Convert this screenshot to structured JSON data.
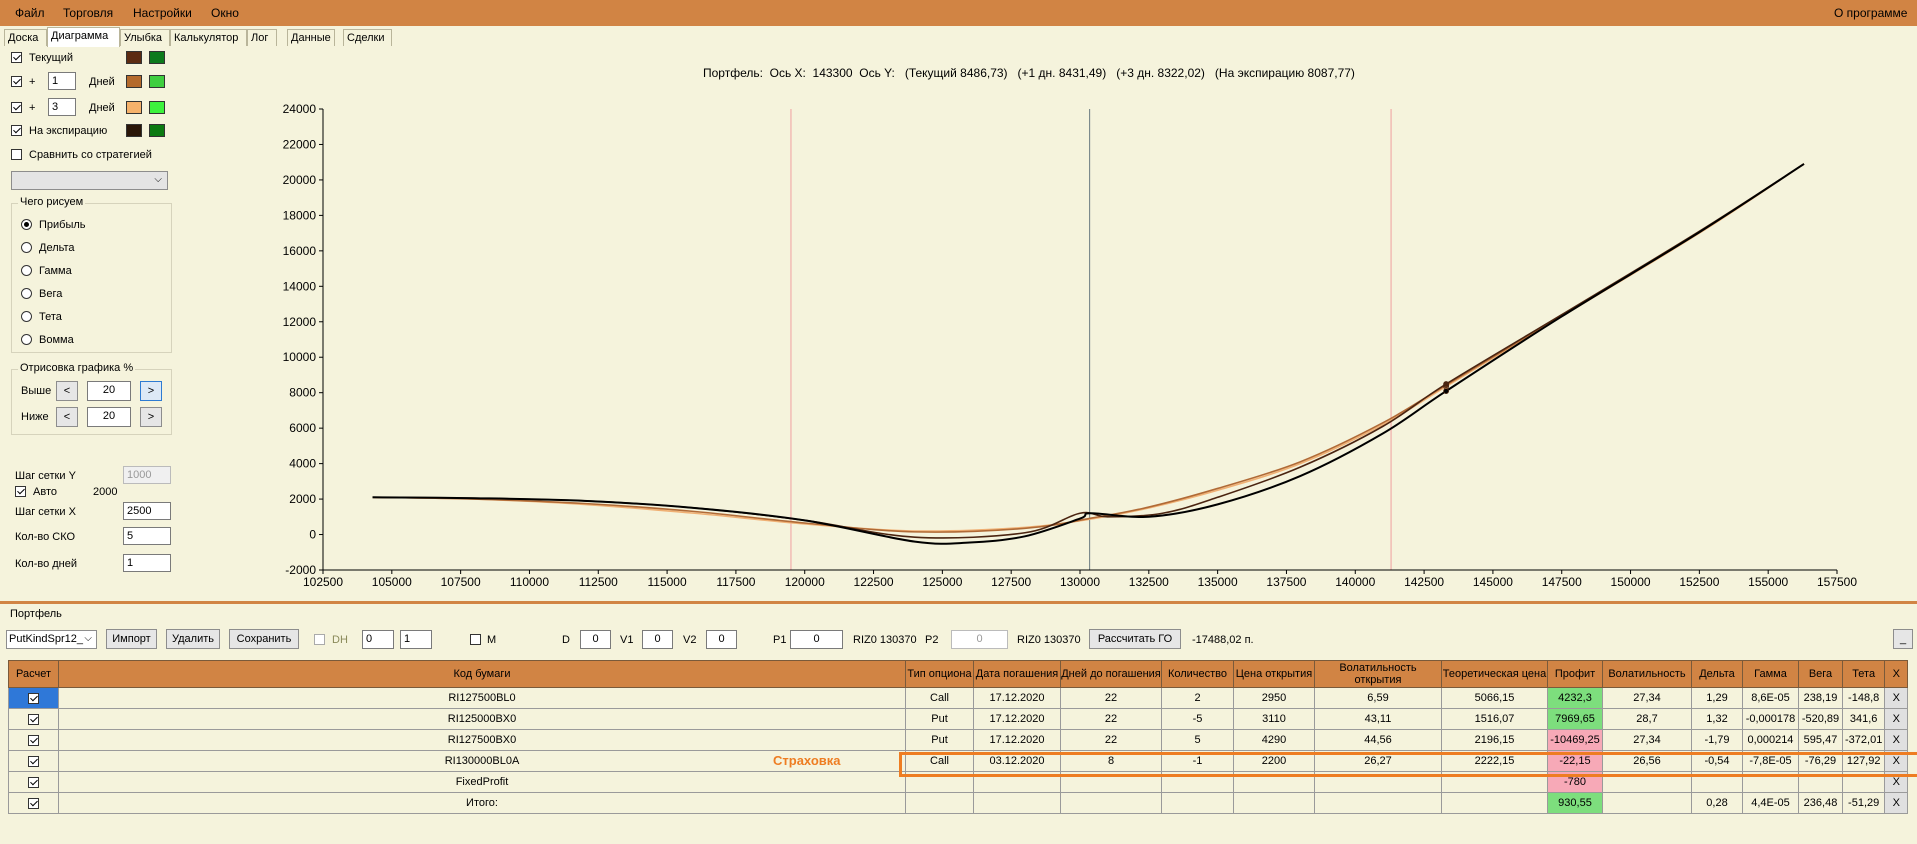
{
  "menu": {
    "items": [
      "Файл",
      "Торговля",
      "Настройки",
      "Окно"
    ],
    "about": "О программе"
  },
  "tabs": [
    "Доска",
    "Диаграмма",
    "Улыбка",
    "Калькулятор",
    "Лог",
    "Данные",
    "Сделки"
  ],
  "active_tab": "Диаграмма",
  "left": {
    "current_label": "Текущий",
    "plus_label": "+",
    "days_label": "Дней",
    "plus1_value": "1",
    "plus3_value": "3",
    "expiry_label": "На экспирацию",
    "compare_label": "Сравнить со стратегией",
    "swatches": {
      "current": [
        "#5c2b12",
        "#0d7a1c"
      ],
      "plus1": [
        "#b46a2c",
        "#3fce3f"
      ],
      "plus3": [
        "#f6b26b",
        "#3df23d"
      ],
      "expiry": [
        "#2a1608",
        "#0c7a12"
      ]
    },
    "draw_group_title": "Чего рисуем",
    "radio_options": [
      "Прибыль",
      "Дельта",
      "Гамма",
      "Вега",
      "Тета",
      "Вомма"
    ],
    "radio_selected": "Прибыль",
    "render_group_title": "Отрисовка графика %",
    "above_label": "Выше",
    "above_value": "20",
    "below_label": "Ниже",
    "below_value": "20",
    "prev_symbol": "<",
    "next_symbol": ">",
    "grid_y_label": "Шаг сетки Y",
    "grid_y_value": "1000",
    "auto_label": "Авто",
    "auto_value": "2000",
    "grid_x_label": "Шаг сетки X",
    "grid_x_value": "2500",
    "sko_label": "Кол-во СКО",
    "sko_value": "5",
    "days_count_label": "Кол-во дней",
    "days_count_value": "1"
  },
  "chart_header": "Портфель:  Ось X:  143300  Ось Y:   (Текущий 8486,73)   (+1 дн. 8431,49)   (+3 дн. 8322,02)   (На экспирацию 8087,77)",
  "chart_data": {
    "type": "line",
    "xlim": [
      102500,
      157500
    ],
    "ylim": [
      -2000,
      24000
    ],
    "x_ticks": [
      102500,
      105000,
      107500,
      110000,
      112500,
      115000,
      117500,
      120000,
      122500,
      125000,
      127500,
      130000,
      132500,
      135000,
      137500,
      140000,
      142500,
      145000,
      147500,
      150000,
      152500,
      155000,
      157500
    ],
    "y_ticks": [
      -2000,
      0,
      2000,
      4000,
      6000,
      8000,
      10000,
      12000,
      14000,
      16000,
      18000,
      20000,
      22000,
      24000
    ],
    "vlines_red": [
      119500,
      141300
    ],
    "vline_current": 130350,
    "cursor_x": 143300,
    "series": [
      {
        "color": "#f0b074",
        "x": [
          104300,
          108000,
          112000,
          116000,
          120000,
          124000,
          128000,
          130500,
          132500,
          135000,
          138000,
          141000,
          143300,
          147500,
          152500,
          156300
        ],
        "y": [
          2100,
          2000,
          1700,
          1200,
          600,
          200,
          400,
          900,
          1500,
          2500,
          4000,
          6200,
          8350,
          12300,
          17000,
          20900
        ]
      },
      {
        "color": "#b06a36",
        "x": [
          104300,
          108000,
          112000,
          116000,
          120000,
          124000,
          128000,
          130500,
          132500,
          135000,
          138000,
          141000,
          143300,
          147500,
          152500,
          156300
        ],
        "y": [
          2100,
          2000,
          1750,
          1300,
          650,
          150,
          350,
          950,
          1550,
          2600,
          4100,
          6300,
          8430,
          12350,
          17050,
          20900
        ]
      },
      {
        "color": "#4a2410",
        "x": [
          104300,
          108000,
          112000,
          116000,
          120000,
          124000,
          128000,
          130000,
          131000,
          133000,
          135000,
          138000,
          141000,
          143300,
          147500,
          152500,
          156300
        ],
        "y": [
          2100,
          2050,
          1900,
          1500,
          800,
          -150,
          100,
          1200,
          1000,
          1200,
          2100,
          3800,
          6100,
          8490,
          12400,
          17100,
          20900
        ]
      },
      {
        "color": "#000000",
        "x": [
          104300,
          108000,
          112000,
          116000,
          120000,
          124000,
          126000,
          128000,
          130000,
          130400,
          132500,
          135000,
          138000,
          141000,
          143300,
          147500,
          152500,
          156300
        ],
        "y": [
          2100,
          2050,
          1900,
          1500,
          800,
          -400,
          -450,
          -100,
          900,
          1200,
          1000,
          1700,
          3300,
          5700,
          8090,
          12300,
          17050,
          20900
        ]
      }
    ]
  },
  "bottom": {
    "portfolio_label": "Портфель",
    "portfolio_select": "PutKindSpr12_",
    "import_label": "Импорт",
    "delete_label": "Удалить",
    "save_label": "Сохранить",
    "dh_label": "DH",
    "spin1": "0",
    "spin2": "1",
    "m_label": "M",
    "d_label": "D",
    "d_value": "0",
    "v1_label": "V1",
    "v1_value": "0",
    "v2_label": "V2",
    "v2_value": "0",
    "p1_label": "P1",
    "p1_value": "0",
    "riz_label1": "RIZ0 130370",
    "p2_label": "P2",
    "p2_value": "0",
    "riz_label2": "RIZ0 130370",
    "calc_go_label": "Рассчитать ГО",
    "go_value": "-17488,02 п.",
    "minimize_label": "_"
  },
  "table": {
    "headers": [
      "Расчет",
      "Код бумаги",
      "Тип опциона",
      "Дата погашения",
      "Дней до погашения",
      "Количество",
      "Цена открытия",
      "Волатильность открытия",
      "Теоретическая цена",
      "Профит",
      "Волатильность",
      "Дельта",
      "Гамма",
      "Вега",
      "Тета",
      "X"
    ],
    "rows": [
      {
        "code": "RI127500BL0",
        "type": "Call",
        "date": "17.12.2020",
        "days": "22",
        "qty": "2",
        "price": "2950",
        "vol_open": "6,59",
        "theor": "5066,15",
        "profit": "4232,3",
        "profit_color": "green",
        "vol": "27,34",
        "delta": "1,29",
        "gamma": "8,6E-05",
        "vega": "238,19",
        "theta": "-148,8",
        "x": "X"
      },
      {
        "code": "RI125000BX0",
        "type": "Put",
        "date": "17.12.2020",
        "days": "22",
        "qty": "-5",
        "price": "3110",
        "vol_open": "43,11",
        "theor": "1516,07",
        "profit": "7969,65",
        "profit_color": "green",
        "vol": "28,7",
        "delta": "1,32",
        "gamma": "-0,000178",
        "vega": "-520,89",
        "theta": "341,6",
        "x": "X"
      },
      {
        "code": "RI127500BX0",
        "type": "Put",
        "date": "17.12.2020",
        "days": "22",
        "qty": "5",
        "price": "4290",
        "vol_open": "44,56",
        "theor": "2196,15",
        "profit": "-10469,25",
        "profit_color": "pink",
        "vol": "27,34",
        "delta": "-1,79",
        "gamma": "0,000214",
        "vega": "595,47",
        "theta": "-372,01",
        "x": "X"
      },
      {
        "code": "RI130000BL0A",
        "type": "Call",
        "date": "03.12.2020",
        "days": "8",
        "qty": "-1",
        "price": "2200",
        "vol_open": "26,27",
        "theor": "2222,15",
        "profit": "-22,15",
        "profit_color": "pink",
        "vol": "26,56",
        "delta": "-0,54",
        "gamma": "-7,8E-05",
        "vega": "-76,29",
        "theta": "127,92",
        "x": "X"
      },
      {
        "code": "FixedProfit",
        "type": "",
        "date": "",
        "days": "",
        "qty": "",
        "price": "",
        "vol_open": "",
        "theor": "",
        "profit": "-780",
        "profit_color": "pink",
        "vol": "",
        "delta": "",
        "gamma": "",
        "vega": "",
        "theta": "",
        "x": "X"
      },
      {
        "code": "Итого:",
        "type": "",
        "date": "",
        "days": "",
        "qty": "",
        "price": "",
        "vol_open": "",
        "theor": "",
        "profit": "930,55",
        "profit_color": "green",
        "vol": "",
        "delta": "0,28",
        "gamma": "4,4E-05",
        "vega": "236,48",
        "theta": "-51,29",
        "x": "X"
      }
    ]
  },
  "annotation": {
    "label": "Страховка",
    "color": "#ee7d22"
  }
}
